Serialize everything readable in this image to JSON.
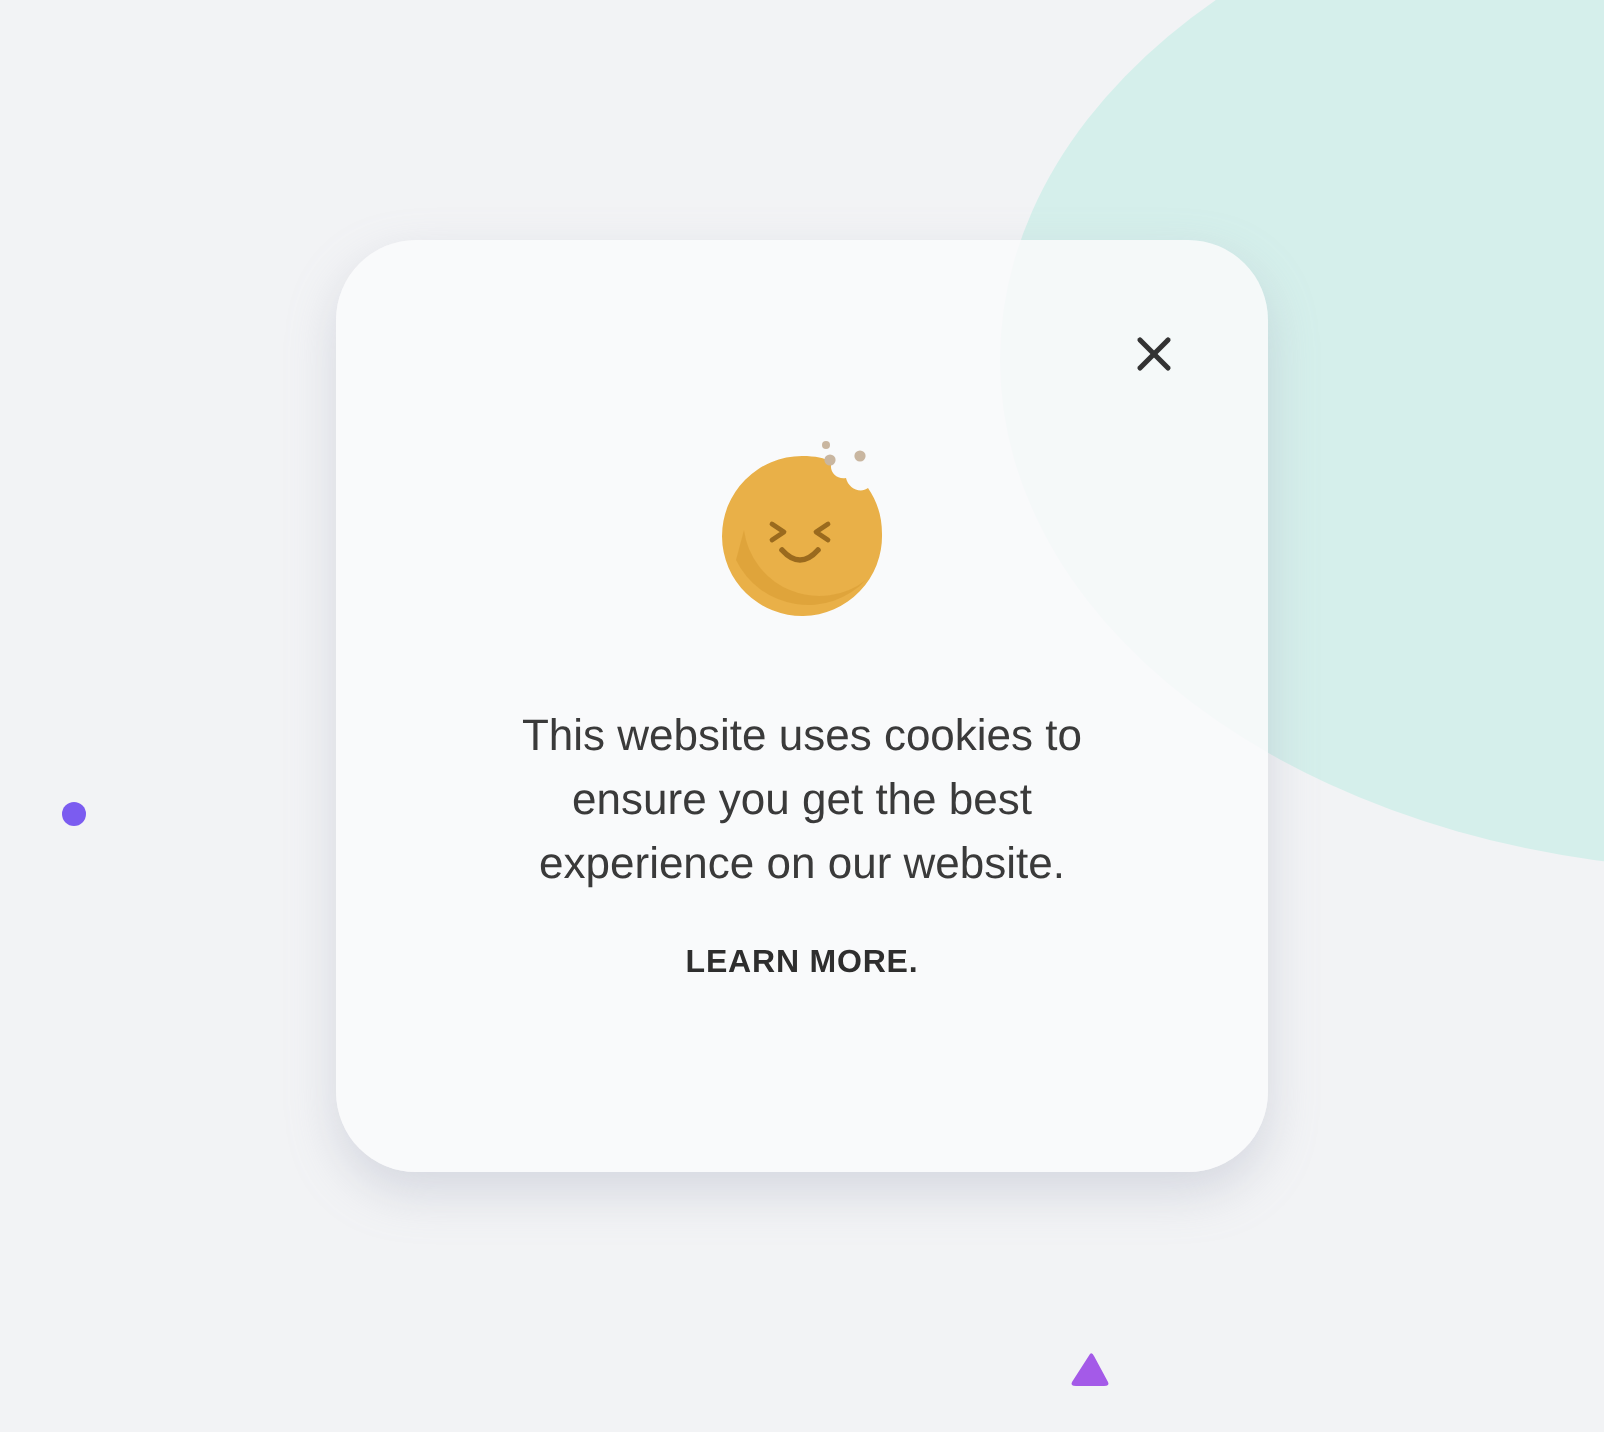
{
  "cookie_dialog": {
    "message": "This website uses cookies to ensure you get the best experience on our website.",
    "link": "LEARN MORE."
  }
}
